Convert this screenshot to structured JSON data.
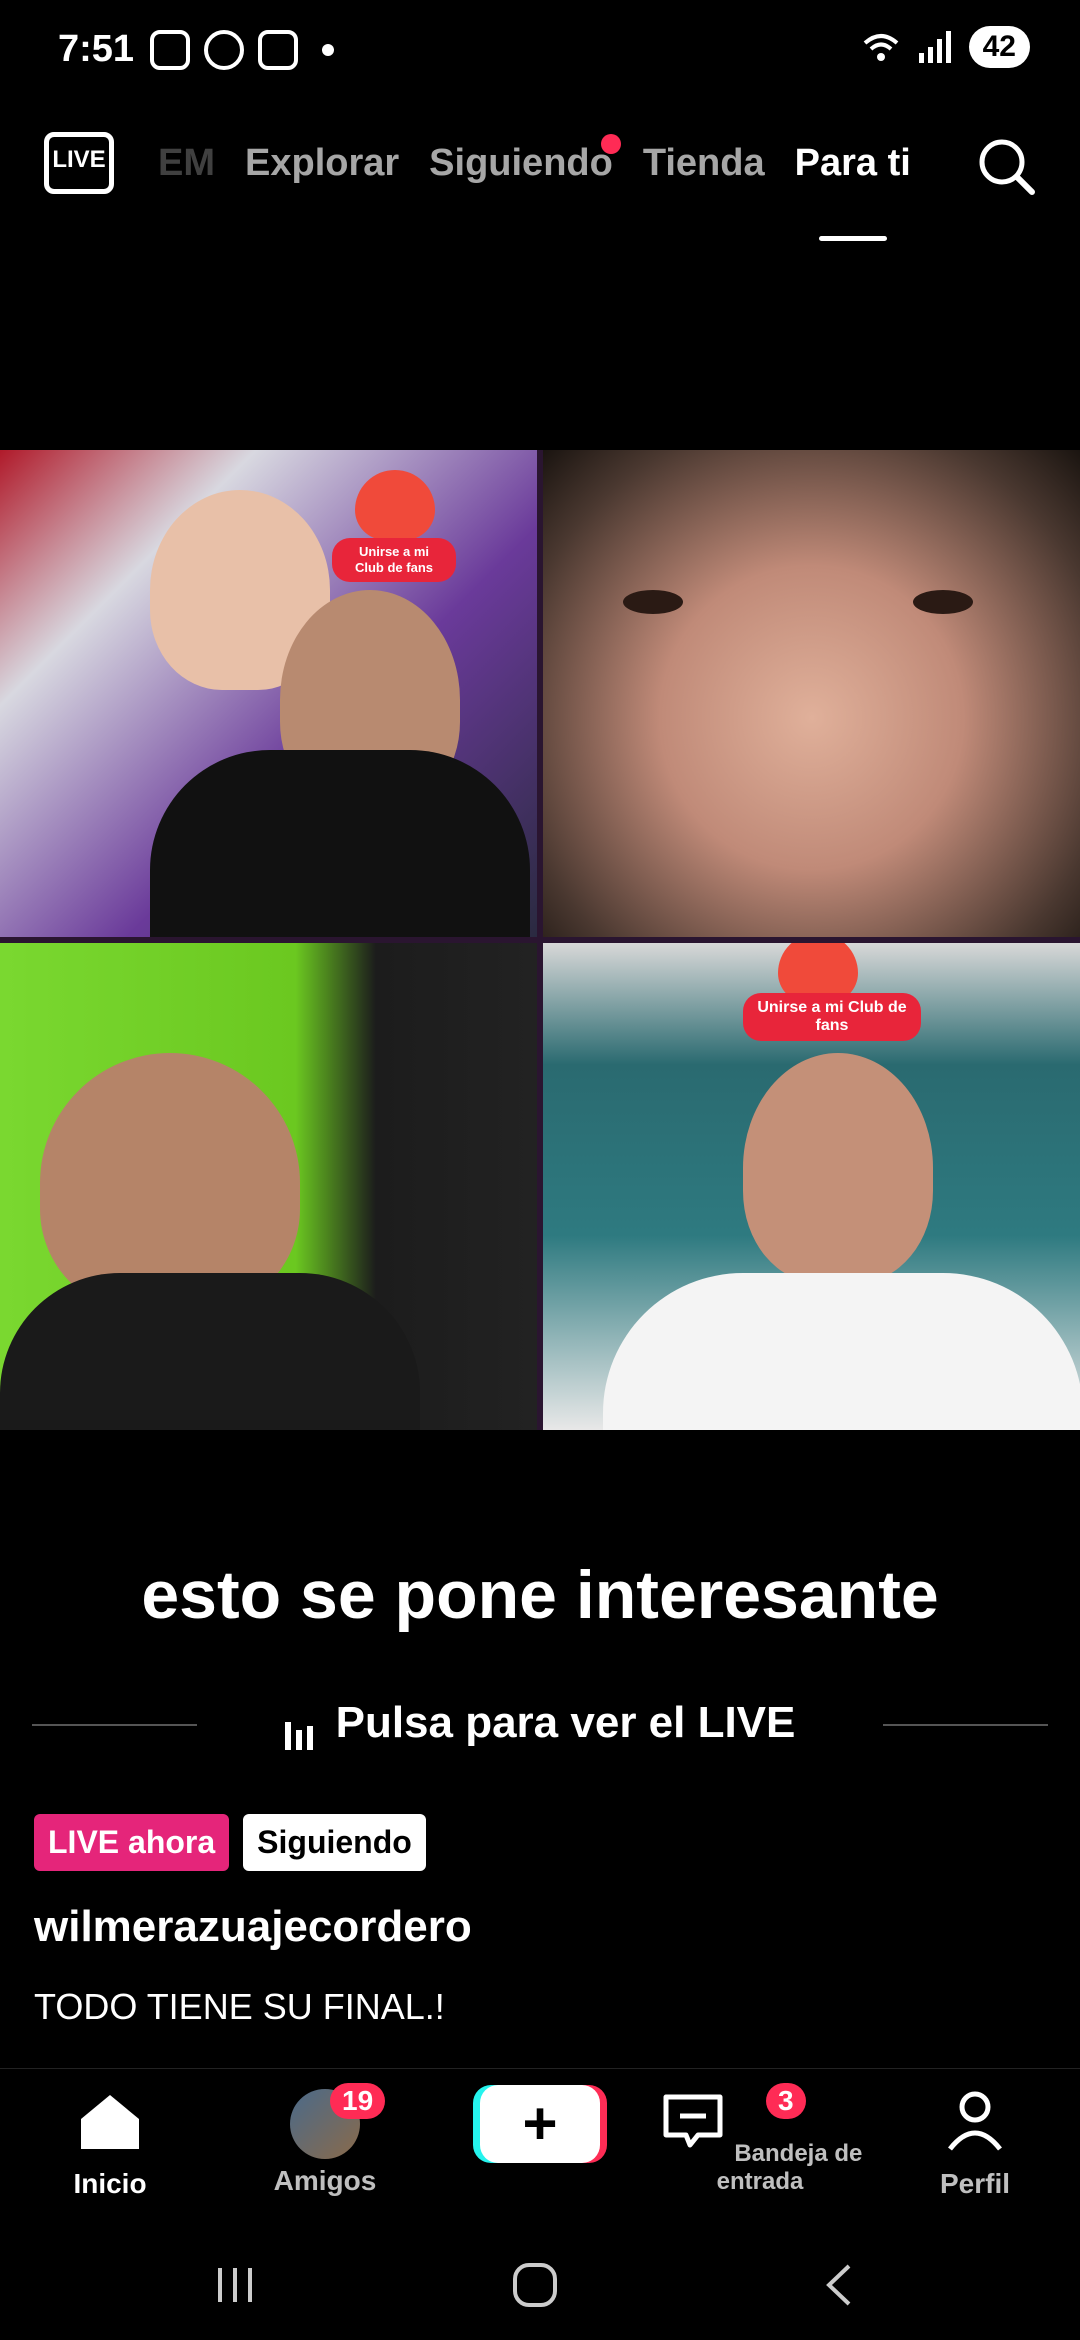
{
  "status_bar": {
    "time": "7:51",
    "battery": "42"
  },
  "top_nav": {
    "live_label": "LIVE",
    "tabs": [
      {
        "label": "EM"
      },
      {
        "label": "Explorar"
      },
      {
        "label": "Siguiendo"
      },
      {
        "label": "Tienda"
      },
      {
        "label": "Para ti"
      }
    ],
    "active_tab": "Para ti"
  },
  "video": {
    "fan_club_badge": "Unirse a mi Club de fans",
    "caption": "esto se pone interesante",
    "watch_prompt": "Pulsa para ver el LIVE"
  },
  "post": {
    "live_badge": "LIVE ahora",
    "follow_badge": "Siguiendo",
    "username": "wilmerazuajecordero",
    "description": "TODO TIENE SU FINAL.!"
  },
  "bottom_nav": {
    "home": "Inicio",
    "friends": "Amigos",
    "friends_count": "19",
    "inbox": "Bandeja de entrada",
    "inbox_count": "3",
    "profile": "Perfil"
  },
  "colors": {
    "accent": "#ff2b55",
    "live_badge": "#e5257a",
    "create_cyan": "#25f4ee"
  }
}
